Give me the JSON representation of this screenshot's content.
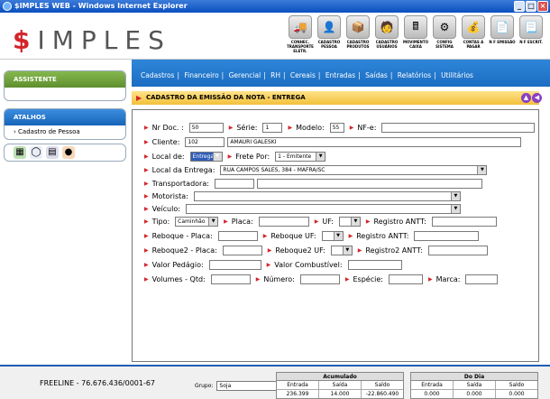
{
  "window": {
    "title": "$IMPLES WEB - Windows Internet Explorer"
  },
  "logo": {
    "dollar": "$",
    "text": "IMPLES"
  },
  "toolbar": [
    {
      "label": "CONHEC. TRANSPORTE ELETR.",
      "icon": "truck-icon"
    },
    {
      "label": "CADASTRO PESSOA",
      "icon": "person-icon"
    },
    {
      "label": "CADASTRO PRODUTOS",
      "icon": "box-icon"
    },
    {
      "label": "CADASTRO USUÁRIOS",
      "icon": "user-icon"
    },
    {
      "label": "MOVIMENTO CAIXA",
      "icon": "cash-register-icon"
    },
    {
      "label": "CONFIG SISTEMA",
      "icon": "config-icon"
    },
    {
      "label": "CONTAS A PAGAR",
      "icon": "money-bag-icon"
    },
    {
      "label": "N F EMISSÃO",
      "icon": "invoice-icon"
    },
    {
      "label": "N F ESCRIT.",
      "icon": "invoice-return-icon"
    }
  ],
  "sidebar": {
    "assistente": "ASSISTENTE",
    "atalhos": "ATALHOS",
    "atalhos_items": [
      "Cadastro de Pessoa"
    ]
  },
  "menu": [
    "Cadastros",
    "Financeiro",
    "Gerencial",
    "RH",
    "Cereais",
    "Entradas",
    "Saídas",
    "Relatórios",
    "Utilitários"
  ],
  "form": {
    "title": "CADASTRO DA EMISSÃO DA NOTA - ENTREGA",
    "nr_doc_label": "Nr Doc. :",
    "nr_doc": "50",
    "serie_label": "Série:",
    "serie": "1",
    "modelo_label": "Modelo:",
    "modelo": "55",
    "nfe_label": "NF-e:",
    "nfe": "",
    "cliente_label": "Cliente:",
    "cliente_code": "102",
    "cliente_name": "AMAURI GALESKI",
    "local_de_label": "Local de:",
    "local_de": "Entrega",
    "frete_label": "Frete Por:",
    "frete": "1 - Emitente",
    "local_entrega_label": "Local da Entrega:",
    "local_entrega": "RUA CAMPOS SALES, 384 - MAFRA/SC",
    "transportadora_label": "Transportadora:",
    "motorista_label": "Motorista:",
    "veiculo_label": "Veículo:",
    "tipo_label": "Tipo:",
    "tipo": "Caminhão",
    "placa_label": "Placa:",
    "uf_label": "UF:",
    "registro_antt_label": "Registro ANTT:",
    "reboque_placa_label": "Reboque - Placa:",
    "reboque_uf_label": "Reboque UF:",
    "reboque_antt_label": "Registro ANTT:",
    "reboque2_placa_label": "Reboque2 - Placa:",
    "reboque2_uf_label": "Reboque2 UF:",
    "reboque2_antt_label": "Registro2 ANTT:",
    "valor_pedagio_label": "Valor Pedágio:",
    "valor_combustivel_label": "Valor Combustível:",
    "volumes_qtd_label": "Volumes - Qtd:",
    "numero_label": "Número:",
    "especie_label": "Espécie:",
    "marca_label": "Marca:"
  },
  "footer": {
    "freeline": "FREELINE - 76.676.436/0001-67",
    "grupo_label": "Grupo:",
    "grupo": "Soja",
    "acumulado": {
      "title": "Acumulado",
      "headers": [
        "Entrada",
        "Saída",
        "Saldo"
      ],
      "values": [
        "236.399",
        "14.000",
        "-22.860.490"
      ]
    },
    "do_dia": {
      "title": "Do Dia",
      "headers": [
        "Entrada",
        "Saída",
        "Saldo"
      ],
      "values": [
        "0.000",
        "0.000",
        "0.000"
      ]
    }
  }
}
